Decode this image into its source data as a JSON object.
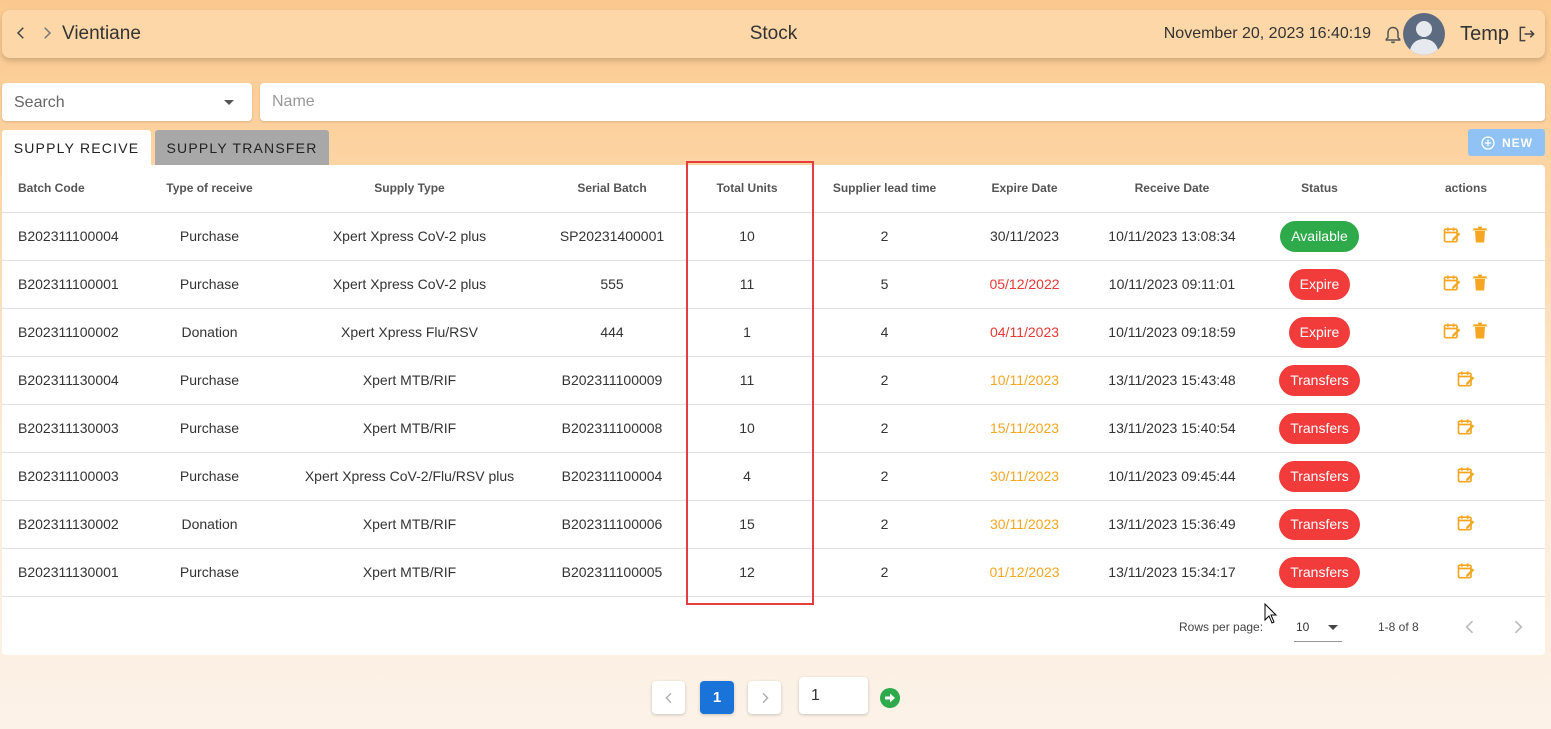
{
  "header": {
    "location": "Vientiane",
    "title": "Stock",
    "datetime": "November 20, 2023 16:40:19",
    "username": "Temp"
  },
  "search": {
    "select_placeholder": "Search",
    "name_placeholder": "Name"
  },
  "tabs": [
    {
      "label": "SUPPLY RECIVE",
      "active": true
    },
    {
      "label": "SUPPLY TRANSFER",
      "active": false
    }
  ],
  "new_button": "NEW",
  "table": {
    "columns": [
      "Batch Code",
      "Type of receive",
      "Supply Type",
      "Serial Batch",
      "Total Units",
      "Supplier lead time",
      "Expire Date",
      "Receive Date",
      "Status",
      "actions"
    ],
    "rows": [
      {
        "batch": "B202311100004",
        "type": "Purchase",
        "supply": "Xpert Xpress CoV-2 plus",
        "serial": "SP20231400001",
        "units": "10",
        "lead": "2",
        "expire": "30/11/2023",
        "expire_state": "normal",
        "receive": "10/11/2023 13:08:34",
        "status": "Available",
        "status_color": "green",
        "delete": true
      },
      {
        "batch": "B202311100001",
        "type": "Purchase",
        "supply": "Xpert Xpress CoV-2 plus",
        "serial": "555",
        "units": "11",
        "lead": "5",
        "expire": "05/12/2022",
        "expire_state": "red",
        "receive": "10/11/2023 09:11:01",
        "status": "Expire",
        "status_color": "red",
        "delete": true
      },
      {
        "batch": "B202311100002",
        "type": "Donation",
        "supply": "Xpert Xpress Flu/RSV",
        "serial": "444",
        "units": "1",
        "lead": "4",
        "expire": "04/11/2023",
        "expire_state": "red",
        "receive": "10/11/2023 09:18:59",
        "status": "Expire",
        "status_color": "red",
        "delete": true
      },
      {
        "batch": "B202311130004",
        "type": "Purchase",
        "supply": "Xpert MTB/RIF",
        "serial": "B202311100009",
        "units": "11",
        "lead": "2",
        "expire": "10/11/2023",
        "expire_state": "orange",
        "receive": "13/11/2023 15:43:48",
        "status": "Transfers",
        "status_color": "red",
        "delete": false
      },
      {
        "batch": "B202311130003",
        "type": "Purchase",
        "supply": "Xpert MTB/RIF",
        "serial": "B202311100008",
        "units": "10",
        "lead": "2",
        "expire": "15/11/2023",
        "expire_state": "orange",
        "receive": "13/11/2023 15:40:54",
        "status": "Transfers",
        "status_color": "red",
        "delete": false
      },
      {
        "batch": "B202311100003",
        "type": "Purchase",
        "supply": "Xpert Xpress CoV-2/Flu/RSV plus",
        "serial": "B202311100004",
        "units": "4",
        "lead": "2",
        "expire": "30/11/2023",
        "expire_state": "orange",
        "receive": "10/11/2023 09:45:44",
        "status": "Transfers",
        "status_color": "red",
        "delete": false
      },
      {
        "batch": "B202311130002",
        "type": "Donation",
        "supply": "Xpert MTB/RIF",
        "serial": "B202311100006",
        "units": "15",
        "lead": "2",
        "expire": "30/11/2023",
        "expire_state": "orange",
        "receive": "13/11/2023 15:36:49",
        "status": "Transfers",
        "status_color": "red",
        "delete": false
      },
      {
        "batch": "B202311130001",
        "type": "Purchase",
        "supply": "Xpert MTB/RIF",
        "serial": "B202311100005",
        "units": "12",
        "lead": "2",
        "expire": "01/12/2023",
        "expire_state": "orange",
        "receive": "13/11/2023 15:34:17",
        "status": "Transfers",
        "status_color": "red",
        "delete": false
      }
    ]
  },
  "table_footer": {
    "rows_per_page_label": "Rows per page:",
    "rows_per_page_value": "10",
    "range": "1-8 of 8"
  },
  "pagination": {
    "current_page": "1",
    "page_input_value": "1"
  },
  "colors": {
    "accent": "#f5a623",
    "available": "#2eaa4a",
    "danger": "#f23b3b",
    "primary": "#1a73d8"
  },
  "icons": [
    "chevron-left-icon",
    "chevron-right-icon",
    "bell-icon",
    "avatar",
    "logout-icon",
    "add-circle-icon",
    "edit-calendar-icon",
    "trash-icon",
    "go-arrow-icon"
  ]
}
